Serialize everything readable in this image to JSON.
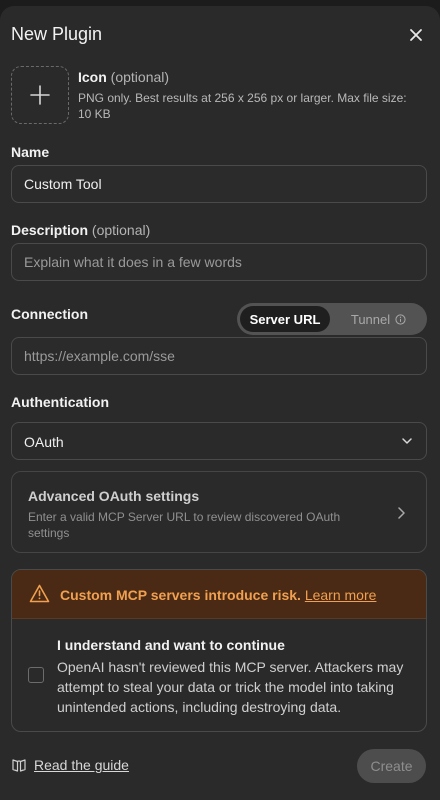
{
  "header": {
    "title": "New Plugin"
  },
  "icon_section": {
    "label": "Icon",
    "optional": "(optional)",
    "help": "PNG only. Best results at 256 x 256 px or larger. Max file size: 10 KB"
  },
  "name": {
    "label": "Name",
    "value": "Custom Tool"
  },
  "description": {
    "label": "Description",
    "optional": "(optional)",
    "placeholder": "Explain what it does in a few words"
  },
  "connection": {
    "label": "Connection",
    "tabs": [
      "Server URL",
      "Tunnel"
    ],
    "selected": "Server URL",
    "url_placeholder": "https://example.com/sse"
  },
  "authentication": {
    "label": "Authentication",
    "selected": "OAuth"
  },
  "advanced": {
    "title": "Advanced OAuth settings",
    "description": "Enter a valid MCP Server URL to review discovered OAuth settings"
  },
  "warning": {
    "text": "Custom MCP servers introduce risk.",
    "link": "Learn more",
    "color": "#f0a050"
  },
  "acknowledge": {
    "title": "I understand and want to continue",
    "description": "OpenAI hasn't reviewed this MCP server. Attackers may attempt to steal your data or trick the model into taking unintended actions, including destroying data.",
    "checked": false
  },
  "footer": {
    "guide_link": "Read the guide",
    "create_label": "Create"
  }
}
